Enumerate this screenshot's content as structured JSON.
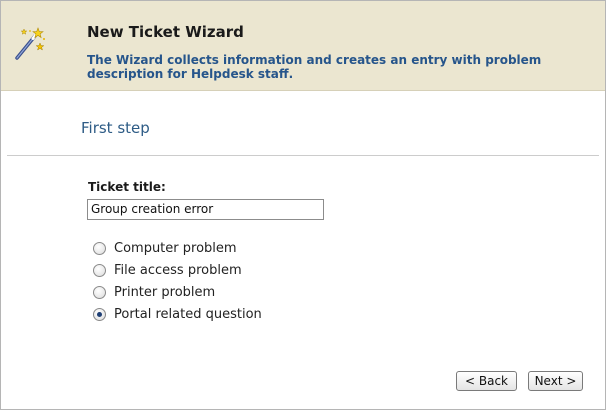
{
  "header": {
    "title": "New Ticket Wizard",
    "description": "The Wizard collects information and creates an entry with problem description for Helpdesk staff.",
    "icon": "magic-wand-icon"
  },
  "step": {
    "title": "First step"
  },
  "form": {
    "ticket_title_label": "Ticket title:",
    "ticket_title_value": "Group creation error",
    "options": [
      {
        "label": "Computer problem",
        "checked": false
      },
      {
        "label": "File access problem",
        "checked": false
      },
      {
        "label": "Printer problem",
        "checked": false
      },
      {
        "label": "Portal related question",
        "checked": true
      }
    ]
  },
  "buttons": {
    "back_label": "< Back",
    "next_label": "Next >"
  }
}
